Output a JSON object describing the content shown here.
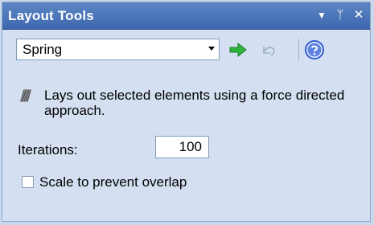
{
  "panel": {
    "title": "Layout Tools",
    "controls": {
      "dropdown": "▼",
      "pin": "ᛘ",
      "close": "✕"
    }
  },
  "toolbar": {
    "algorithm_selected": "Spring",
    "run_icon": "green-right-arrow-icon",
    "undo_icon": "undo-icon",
    "help_icon": "help-circle-icon"
  },
  "description": {
    "icon": "spring-coil-icon",
    "text": "Lays out selected elements using a force directed approach."
  },
  "iterations": {
    "label": "Iterations:",
    "value": "100"
  },
  "scale_option": {
    "label": "Scale to prevent overlap",
    "checked": false
  },
  "colors": {
    "title_bar": "#4a75b8",
    "panel_background": "#d4e0f1",
    "run_arrow": "#2db43b",
    "help": "#2f5dcc"
  }
}
